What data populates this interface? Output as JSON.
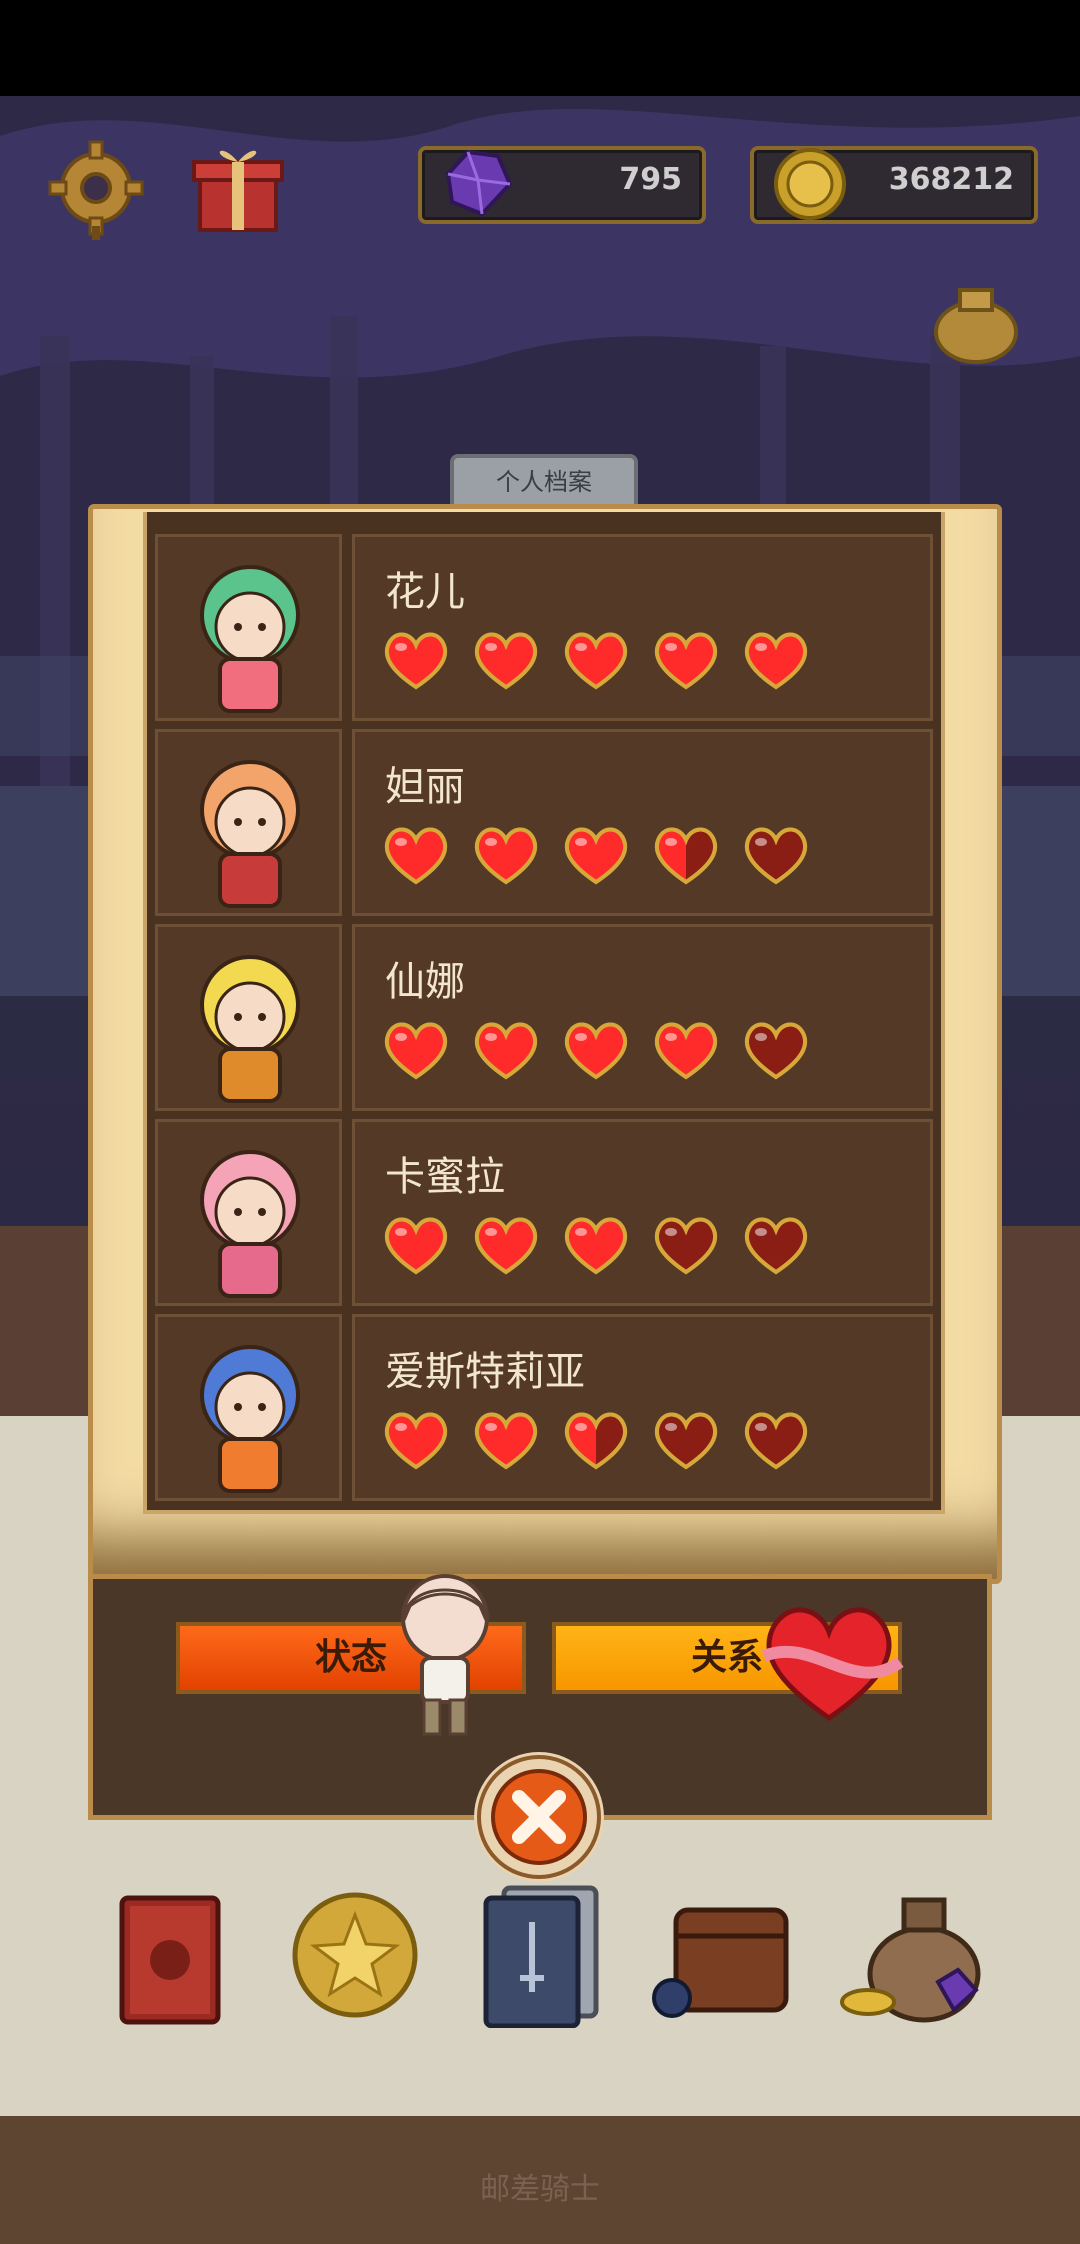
{
  "hud": {
    "gems": "795",
    "gold": "368212"
  },
  "panel": {
    "tab_label": "个人档案",
    "characters": [
      {
        "name": "花儿",
        "hearts": 5,
        "max_hearts": 5,
        "hair": "#5bc48c",
        "accent": "#f06e7e"
      },
      {
        "name": "妲丽",
        "hearts": 3.5,
        "max_hearts": 5,
        "hair": "#f2a46a",
        "accent": "#c73b3b"
      },
      {
        "name": "仙娜",
        "hearts": 4,
        "max_hearts": 5,
        "hair": "#f3d94f",
        "accent": "#e08b2b"
      },
      {
        "name": "卡蜜拉",
        "hearts": 3,
        "max_hearts": 5,
        "hair": "#f5a3b6",
        "accent": "#e66a8b"
      },
      {
        "name": "爱斯特莉亚",
        "hearts": 2.5,
        "max_hearts": 5,
        "hair": "#4f7bd6",
        "accent": "#f07c30"
      }
    ]
  },
  "buttons": {
    "status": "状态",
    "relation": "关系"
  },
  "footer": {
    "title": "邮差骑士"
  },
  "colors": {
    "heart_full": "#ff2b2b",
    "heart_empty": "#8a1d14",
    "status_button": "#ff5a10",
    "relation_button": "#ffa812"
  }
}
